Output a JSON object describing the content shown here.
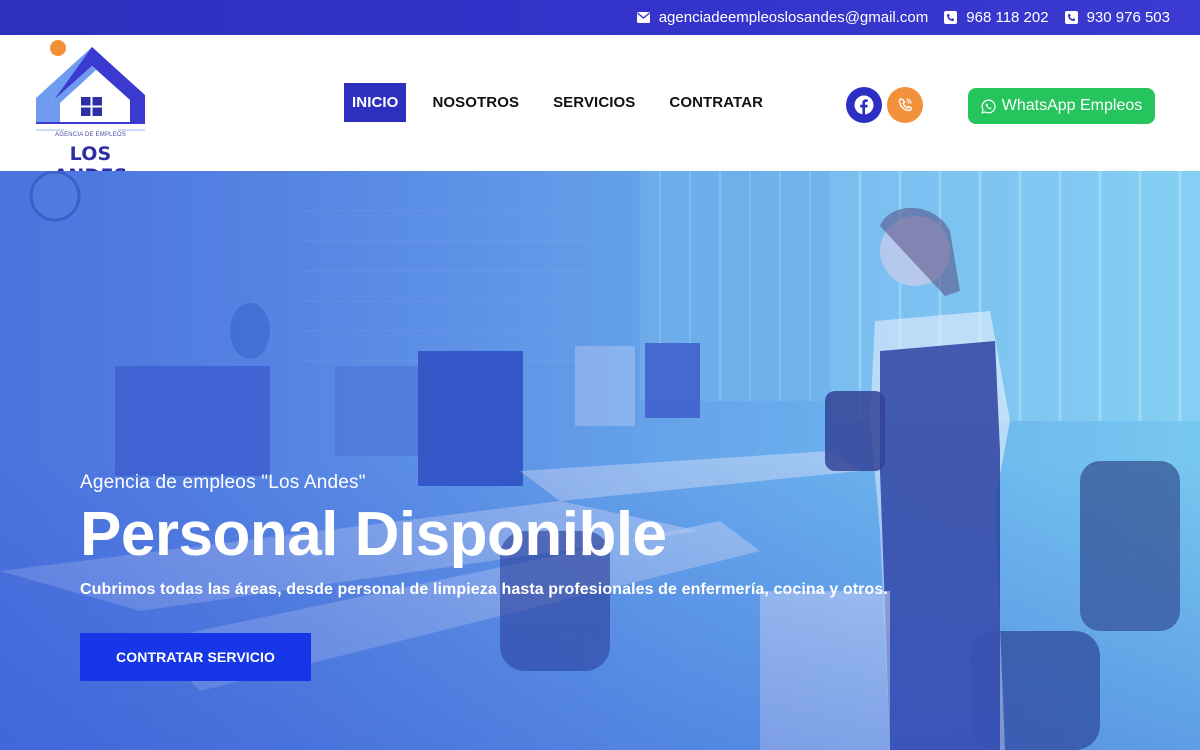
{
  "topbar": {
    "email": "agenciadeempleoslosandes@gmail.com",
    "phone1": "968 118 202",
    "phone2": "930 976 503"
  },
  "logo": {
    "subtitle": "AGENCIA DE EMPLEOS",
    "name": "LOS ANDES"
  },
  "nav": {
    "items": [
      "INICIO",
      "NOSOTROS",
      "SERVICIOS",
      "CONTRATAR"
    ],
    "active": "INICIO"
  },
  "social": {
    "facebook_icon": "facebook-icon",
    "phone_icon": "phone-icon"
  },
  "whatsapp": {
    "label": "WhatsApp Empleos",
    "icon": "whatsapp-icon"
  },
  "hero": {
    "subtitle": "Agencia de empleos \"Los Andes\"",
    "title": "Personal Disponible",
    "description": "Cubrimos todas las áreas, desde personal de limpieza hasta profesionales de enfermería, cocina y otros.",
    "cta_label": "CONTRATAR SERVICIO"
  },
  "colors": {
    "brand_primary": "#2f2fbf",
    "accent_orange": "#f3903a",
    "whatsapp_green": "#25c45c",
    "cta_blue": "#1636e8"
  }
}
